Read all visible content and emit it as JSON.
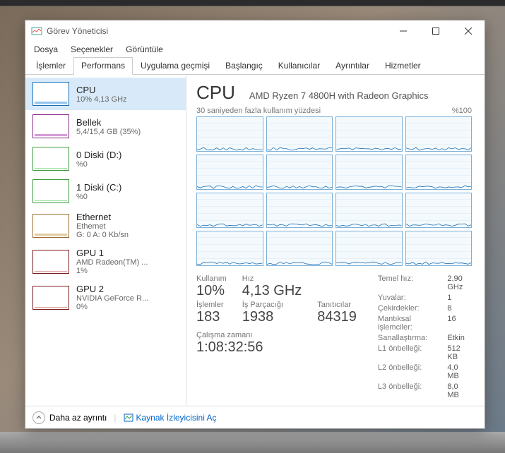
{
  "window": {
    "title": "Görev Yöneticisi"
  },
  "menu": {
    "file": "Dosya",
    "options": "Seçenekler",
    "view": "Görüntüle"
  },
  "tabs": {
    "processes": "İşlemler",
    "performance": "Performans",
    "apphistory": "Uygulama geçmişi",
    "startup": "Başlangıç",
    "users": "Kullanıcılar",
    "details": "Ayrıntılar",
    "services": "Hizmetler"
  },
  "sidebar": {
    "cpu": {
      "title": "CPU",
      "sub": "10% 4,13 GHz"
    },
    "mem": {
      "title": "Bellek",
      "sub": "5,4/15,4 GB (35%)"
    },
    "disk0": {
      "title": "0 Diski (D:)",
      "sub": "%0"
    },
    "disk1": {
      "title": "1 Diski (C:)",
      "sub": "%0"
    },
    "eth": {
      "title": "Ethernet",
      "sub1": "Ethernet",
      "sub2": "G: 0 A: 0 Kb/sn"
    },
    "gpu1": {
      "title": "GPU 1",
      "sub1": "AMD Radeon(TM) ...",
      "sub2": "1%"
    },
    "gpu2": {
      "title": "GPU 2",
      "sub1": "NVIDIA GeForce R...",
      "sub2": "0%"
    }
  },
  "main": {
    "title": "CPU",
    "model": "AMD Ryzen 7 4800H with Radeon Graphics",
    "chart_top_left": "30 saniyeden fazla kullanım yüzdesi",
    "chart_top_right": "%100",
    "stats": {
      "util_label": "Kullanım",
      "util_value": "10%",
      "speed_label": "Hız",
      "speed_value": "4,13 GHz",
      "proc_label": "İşlemler",
      "proc_value": "183",
      "thread_label": "İş Parçacığı",
      "thread_value": "1938",
      "handle_label": "Tanıtıcılar",
      "handle_value": "84319",
      "uptime_label": "Çalışma zamanı",
      "uptime_value": "1:08:32:56"
    },
    "info": {
      "base_k": "Temel hız:",
      "base_v": "2,90 GHz",
      "sockets_k": "Yuvalar:",
      "sockets_v": "1",
      "cores_k": "Çekirdekler:",
      "cores_v": "8",
      "lp_k": "Mantıksal işlemciler:",
      "lp_v": "16",
      "virt_k": "Sanallaştırma:",
      "virt_v": "Etkin",
      "l1_k": "L1 önbelleği:",
      "l1_v": "512 KB",
      "l2_k": "L2 önbelleği:",
      "l2_v": "4,0 MB",
      "l3_k": "L3 önbelleği:",
      "l3_v": "8,0 MB"
    }
  },
  "footer": {
    "fewer": "Daha az ayrıntı",
    "resmon": "Kaynak İzleyicisini Aç"
  },
  "chart_data": {
    "type": "line",
    "title": "30 saniyeden fazla kullanım yüzdesi",
    "ylim": [
      0,
      100
    ],
    "series_count": 16,
    "note": "16 logical-processor utilization sparklines over ~30s; all cores roughly 5–15% with minor spikes"
  }
}
